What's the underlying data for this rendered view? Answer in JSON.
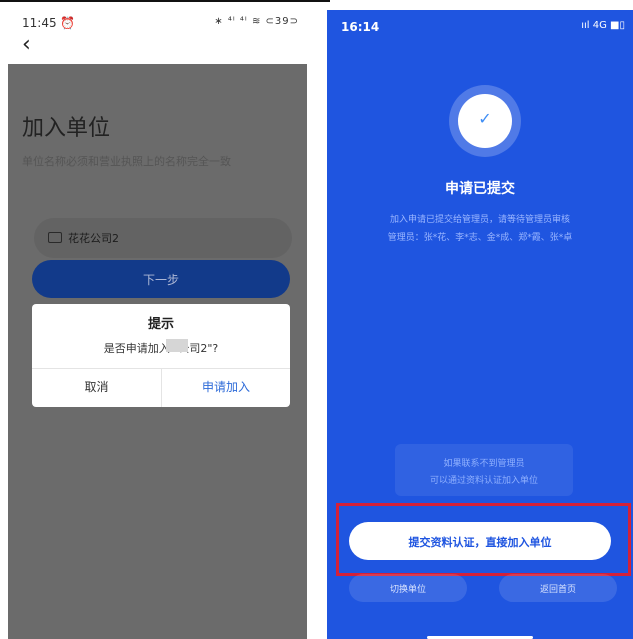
{
  "left": {
    "status": {
      "time": "11:45 ⏰",
      "icons": "∗ ⁴ᴵ ⁴ᴵ ≋ ⊂39⊃"
    },
    "back_icon": "chevron-left-icon",
    "title": "加入单位",
    "subtitle": "单位名称必须和营业执照上的名称完全一致",
    "input": {
      "icon": "building-icon",
      "value": "花花公司2"
    },
    "next_label": "下一步",
    "dialog": {
      "title": "提示",
      "message": "是否申请加入\"          公司2\"?",
      "cancel_label": "取消",
      "confirm_label": "申请加入"
    }
  },
  "right": {
    "status": {
      "time": "16:14",
      "icons": "ııl 4G ■▯"
    },
    "check_icon": "check-icon",
    "check_glyph": "✓",
    "title": "申请已提交",
    "desc_line1": "加入申请已提交给管理员，请等待管理员审核",
    "desc_line2": "管理员：张*花、李*志、金*成、郑*霞、张*卓",
    "contact_line1": "如果联系不到管理员",
    "contact_line2": "可以通过资料认证加入单位",
    "primary_button": "提交资料认证，直接加入单位",
    "switch_button": "切换单位",
    "home_button": "返回首页",
    "highlight_color": "#d3213a",
    "accent_color": "#1f55e0"
  }
}
